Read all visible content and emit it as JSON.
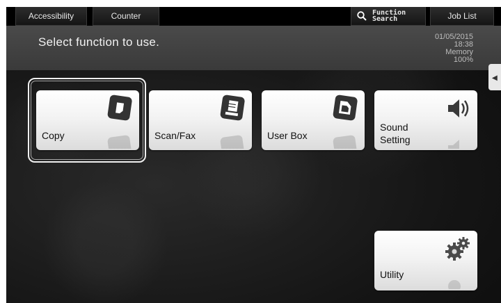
{
  "topbar": {
    "accessibility_label": "Accessibility",
    "counter_label": "Counter",
    "function_search_line1": "Function",
    "function_search_line2": "Search",
    "job_list_label": "Job List"
  },
  "header": {
    "title": "Select function to use.",
    "date": "01/05/2015",
    "time": "18:38",
    "memory_label": "Memory",
    "memory_value": "100%"
  },
  "tiles": [
    {
      "label": "Copy",
      "icon": "copy-icon"
    },
    {
      "label": "Scan/Fax",
      "icon": "scan-fax-icon"
    },
    {
      "label": "User Box",
      "icon": "user-box-icon"
    },
    {
      "label_line1": "Sound",
      "label_line2": "Setting",
      "icon": "speaker-icon"
    },
    {
      "label": "Utility",
      "icon": "gears-icon"
    }
  ],
  "side_tab": {
    "symbol": "◂"
  },
  "colors": {
    "selected_frame": "#f0f0f0",
    "tile_gradient_top": "#ffffff",
    "tile_gradient_bottom": "#dcdcdc",
    "icon_dark": "#2f2f2f"
  }
}
